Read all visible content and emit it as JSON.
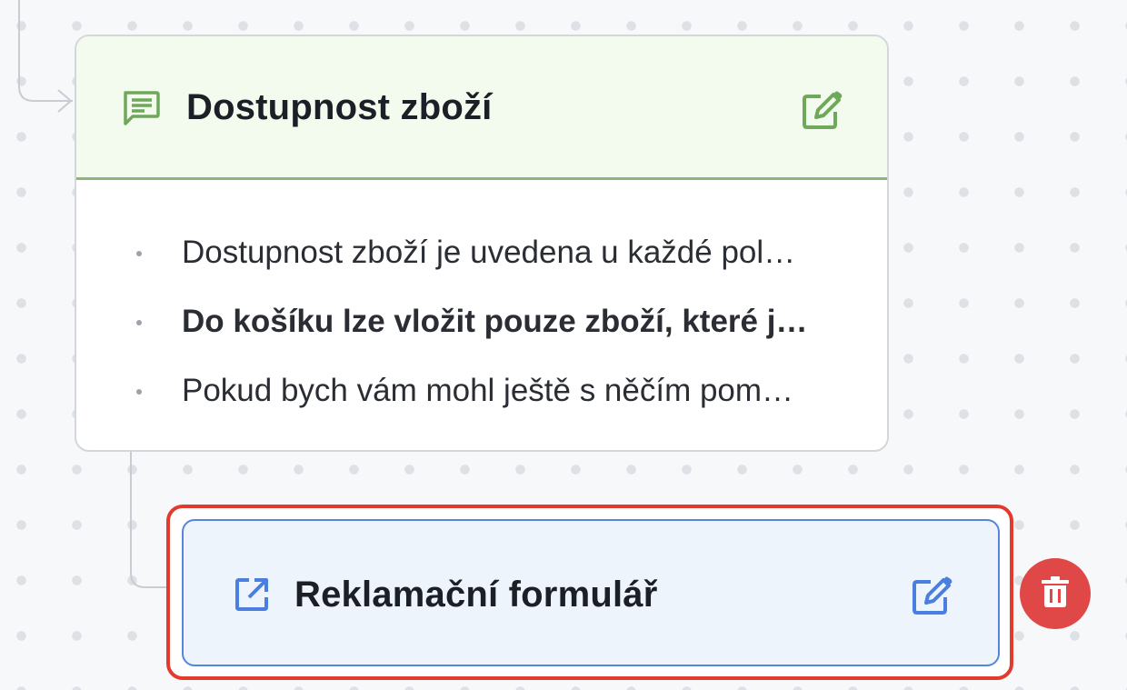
{
  "flow": {
    "message_node": {
      "title": "Dostupnost zboží",
      "icon": "message-icon",
      "edit_icon": "edit-icon",
      "accent_color": "#8db57a",
      "header_bg": "#f3fbef",
      "bullets": [
        {
          "text": "Dostupnost zboží je uvedena u každé pol…",
          "bold": false
        },
        {
          "text": "Do košíku lze vložit pouze zboží, které j…",
          "bold": true
        },
        {
          "text": "Pokud bych vám mohl ještě s něčím pom…",
          "bold": false
        }
      ]
    },
    "redirect_node": {
      "title": "Reklamační formulář",
      "icon": "external-link-icon",
      "edit_icon": "edit-icon",
      "selected": true,
      "accent_color": "#5684e0",
      "selection_color": "#e23b2e"
    },
    "delete_button": {
      "icon": "trash-icon",
      "color": "#e04848"
    }
  }
}
